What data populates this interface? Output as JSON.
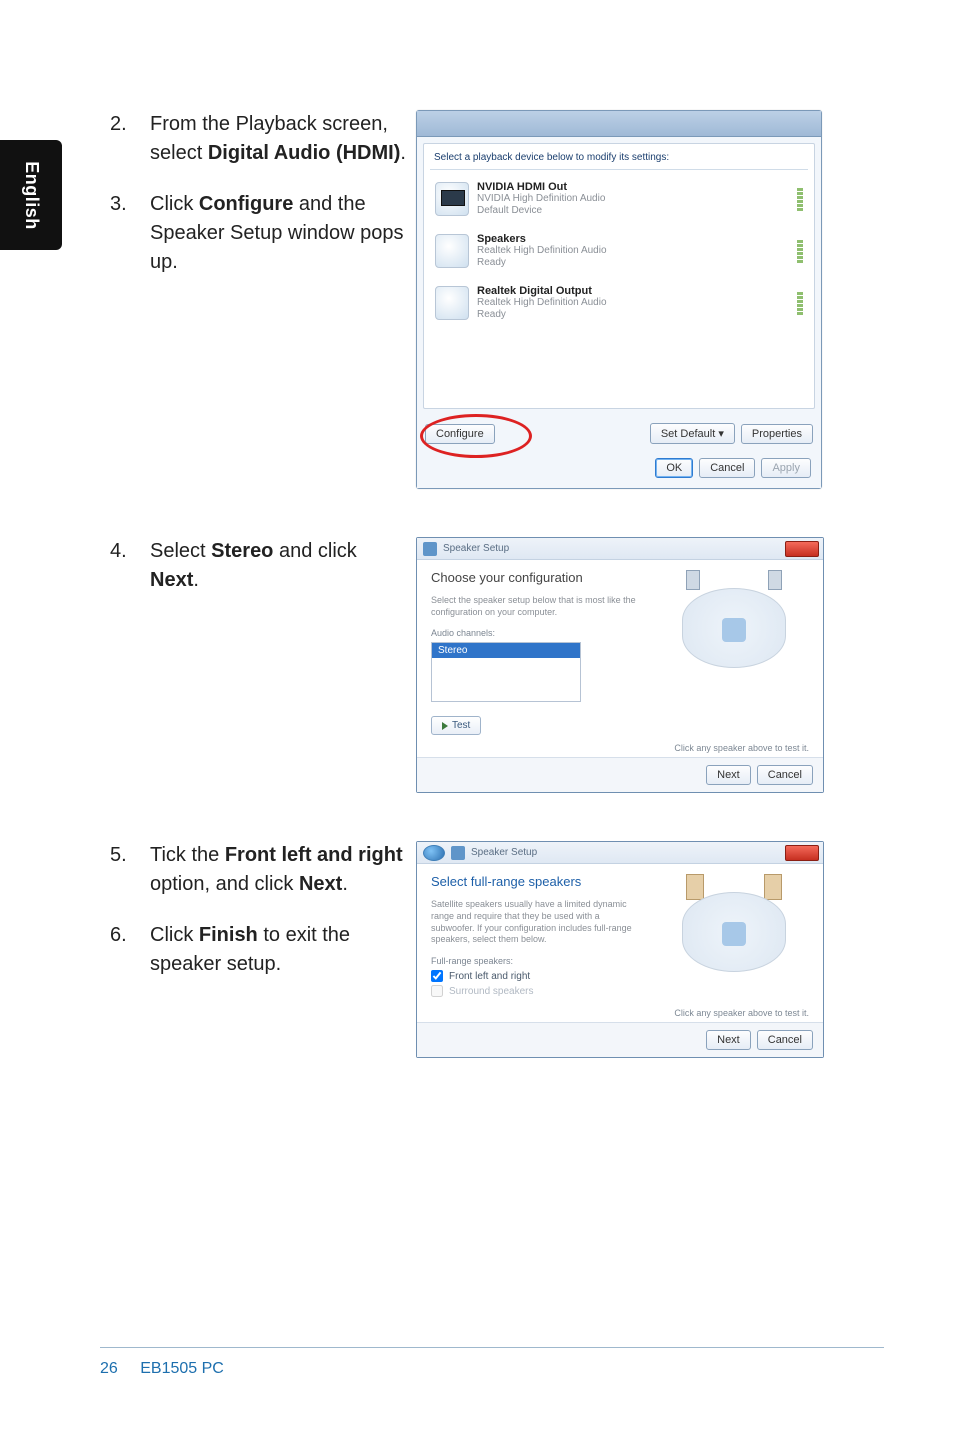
{
  "side_tab": "English",
  "steps_block1": [
    {
      "num": "2.",
      "html": "From the Playback screen, select <b>Digital Audio (HDMI)</b>."
    },
    {
      "num": "3.",
      "html": "Click <b>Configure</b> and the Speaker Setup window pops up."
    }
  ],
  "steps_block2": [
    {
      "num": "4.",
      "html": "Select <b>Stereo</b> and click <b>Next</b>."
    }
  ],
  "steps_block3": [
    {
      "num": "5.",
      "html": "Tick the <b>Front left and right</b> option, and click <b>Next</b>."
    },
    {
      "num": "6.",
      "html": "Click <b>Finish</b> to exit the speaker setup."
    }
  ],
  "dlg1": {
    "caption": "Select a playback device below to modify its settings:",
    "devices": [
      {
        "title": "NVIDIA HDMI Out",
        "line2": "NVIDIA High Definition Audio",
        "line3": "Default Device"
      },
      {
        "title": "Speakers",
        "line2": "Realtek High Definition Audio",
        "line3": "Ready"
      },
      {
        "title": "Realtek Digital Output",
        "line2": "Realtek High Definition Audio",
        "line3": "Ready"
      }
    ],
    "buttons": {
      "configure": "Configure",
      "setdefault": "Set Default",
      "properties": "Properties",
      "ok": "OK",
      "cancel": "Cancel",
      "apply": "Apply"
    }
  },
  "dlg2": {
    "title": "Speaker Setup",
    "heading": "Choose your configuration",
    "desc": "Select the speaker setup below that is most like the configuration on your computer.",
    "list_label": "Audio channels:",
    "list_selected": "Stereo",
    "test": "Test",
    "hint": "Click any speaker above to test it.",
    "next": "Next",
    "cancel": "Cancel"
  },
  "dlg3": {
    "title": "Speaker Setup",
    "heading": "Select full-range speakers",
    "desc": "Satellite speakers usually have a limited dynamic range and require that they be used with a subwoofer. If your configuration includes full-range speakers, select them below.",
    "group_label": "Full-range speakers:",
    "opt1": "Front left and right",
    "opt2": "Surround speakers",
    "hint": "Click any speaker above to test it.",
    "next": "Next",
    "cancel": "Cancel"
  },
  "footer": {
    "page": "26",
    "title": "EB1505 PC"
  }
}
